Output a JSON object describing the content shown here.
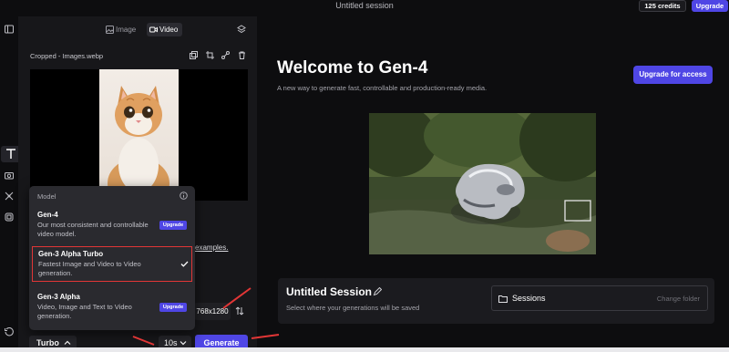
{
  "app": {
    "session_title": "Untitled session",
    "credits": "125 credits",
    "upgrade_label": "Upgrade"
  },
  "rail": {
    "icons": [
      "panel-icon",
      "text-icon",
      "camera-icon",
      "crop-icon",
      "layers-icon",
      "history-icon"
    ]
  },
  "panel": {
    "tabs": [
      {
        "label": "Image",
        "icon": "image-icon",
        "active": false
      },
      {
        "label": "Video",
        "icon": "video-icon",
        "active": true
      }
    ],
    "file_label": "Cropped - Images.webp",
    "hint_link": "examples.",
    "resolution": "768x1280",
    "mode_label": "Turbo",
    "duration_label": "10s",
    "generate_label": "Generate"
  },
  "model_menu": {
    "heading": "Model",
    "options": [
      {
        "name": "Gen-4",
        "desc": "Our most consistent and controllable video model.",
        "badge": "Upgrade",
        "selected": false
      },
      {
        "name": "Gen-3 Alpha Turbo",
        "desc": "Fastest Image and Video to Video generation.",
        "badge": "",
        "selected": true
      },
      {
        "name": "Gen-3 Alpha",
        "desc": "Video, Image and Text to Video generation.",
        "badge": "Upgrade",
        "selected": false
      }
    ]
  },
  "main": {
    "title": "Welcome to Gen-4",
    "subtitle": "A new way to generate fast, controllable and production-ready media.",
    "upgrade_access": "Upgrade for access"
  },
  "session": {
    "title": "Untitled Session",
    "subtitle": "Select where your generations will be saved",
    "folder_label": "Sessions",
    "change_folder": "Change folder"
  },
  "colors": {
    "accent": "#4f46e5",
    "highlight": "#e23636",
    "background": "#0d0d0f",
    "panel": "#17171a"
  }
}
